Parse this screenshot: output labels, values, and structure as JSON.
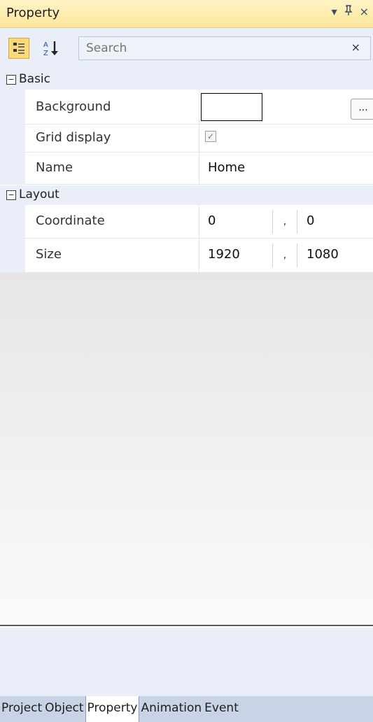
{
  "panel": {
    "title": "Property",
    "buttons": {
      "dropdown": "▾",
      "pin": "📌",
      "close": "×"
    }
  },
  "toolbar": {
    "categorized_icon": "categorized-icon",
    "sort_icon": "sort-az-icon",
    "search": {
      "placeholder": "Search",
      "value": ""
    },
    "clear": "×"
  },
  "grid": {
    "categories": [
      {
        "label": "Basic",
        "toggle": "−",
        "props": [
          {
            "name": "Background",
            "value": ""
          },
          {
            "name": "Grid display",
            "value": "✓"
          },
          {
            "name": "Name",
            "value": "Home"
          }
        ]
      },
      {
        "label": "Layout",
        "toggle": "−",
        "props": [
          {
            "name": "Coordinate",
            "a": "0",
            "sep": ",",
            "b": "0"
          },
          {
            "name": "Size",
            "a": "1920",
            "sep": ",",
            "b": "1080"
          }
        ]
      }
    ],
    "ellipsis": "..."
  },
  "tabs": [
    "Project",
    "Object",
    "Property",
    "Animation",
    "Event"
  ],
  "colors": {
    "title_bg": "#fde79b",
    "toolbar_bg": "#e9eef8",
    "tabbar_bg": "#c9d3e6"
  }
}
